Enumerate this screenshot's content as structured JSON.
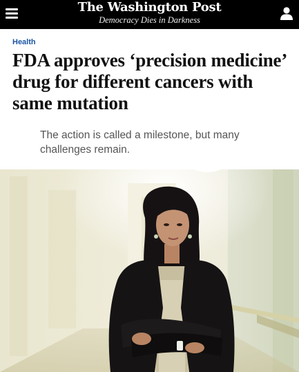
{
  "header": {
    "logo": "The Washington Post",
    "tagline": "Democracy Dies in Darkness",
    "menu_icon": "hamburger-menu-icon",
    "profile_icon": "user-profile-icon",
    "background": "#000000"
  },
  "article": {
    "section": "Health",
    "section_color": "#1955a5",
    "headline": "FDA approves ‘precision medicine’ drug for different cancers with same mutation",
    "subheadline": "The action is called a milestone, but many challenges remain."
  }
}
